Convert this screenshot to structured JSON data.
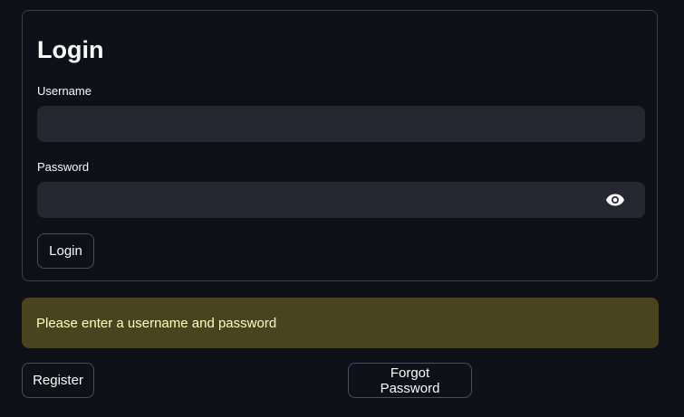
{
  "form": {
    "title": "Login",
    "username_label": "Username",
    "username_value": "",
    "password_label": "Password",
    "password_value": "",
    "submit_label": "Login",
    "password_toggle_icon": "eye-icon"
  },
  "alert": {
    "message": "Please enter a username and password",
    "background": "#4a431f",
    "text_color": "#ffffc2"
  },
  "actions": {
    "register_label": "Register",
    "forgot_label": "Forgot Password"
  },
  "theme": {
    "background": "#0e1117",
    "input_background": "#262730"
  }
}
